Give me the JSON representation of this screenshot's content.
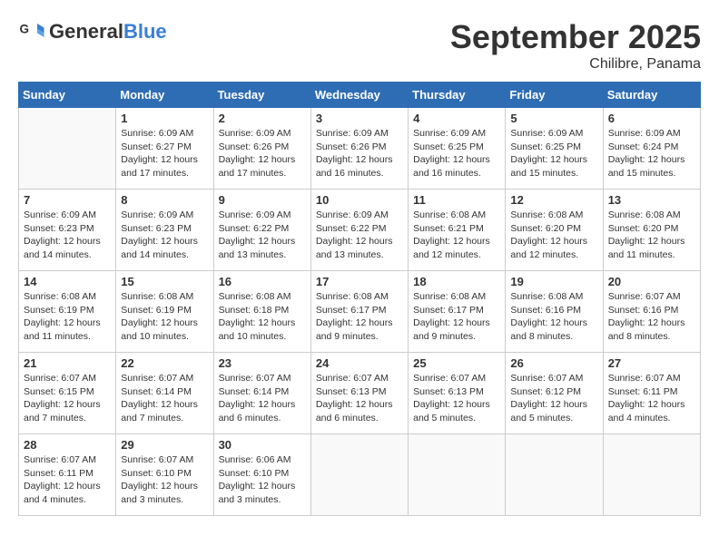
{
  "logo": {
    "general": "General",
    "blue": "Blue"
  },
  "title": "September 2025",
  "location": "Chilibre, Panama",
  "days_of_week": [
    "Sunday",
    "Monday",
    "Tuesday",
    "Wednesday",
    "Thursday",
    "Friday",
    "Saturday"
  ],
  "weeks": [
    [
      {
        "day": "",
        "info": ""
      },
      {
        "day": "1",
        "info": "Sunrise: 6:09 AM\nSunset: 6:27 PM\nDaylight: 12 hours and 17 minutes."
      },
      {
        "day": "2",
        "info": "Sunrise: 6:09 AM\nSunset: 6:26 PM\nDaylight: 12 hours and 17 minutes."
      },
      {
        "day": "3",
        "info": "Sunrise: 6:09 AM\nSunset: 6:26 PM\nDaylight: 12 hours and 16 minutes."
      },
      {
        "day": "4",
        "info": "Sunrise: 6:09 AM\nSunset: 6:25 PM\nDaylight: 12 hours and 16 minutes."
      },
      {
        "day": "5",
        "info": "Sunrise: 6:09 AM\nSunset: 6:25 PM\nDaylight: 12 hours and 15 minutes."
      },
      {
        "day": "6",
        "info": "Sunrise: 6:09 AM\nSunset: 6:24 PM\nDaylight: 12 hours and 15 minutes."
      }
    ],
    [
      {
        "day": "7",
        "info": "Sunrise: 6:09 AM\nSunset: 6:23 PM\nDaylight: 12 hours and 14 minutes."
      },
      {
        "day": "8",
        "info": "Sunrise: 6:09 AM\nSunset: 6:23 PM\nDaylight: 12 hours and 14 minutes."
      },
      {
        "day": "9",
        "info": "Sunrise: 6:09 AM\nSunset: 6:22 PM\nDaylight: 12 hours and 13 minutes."
      },
      {
        "day": "10",
        "info": "Sunrise: 6:09 AM\nSunset: 6:22 PM\nDaylight: 12 hours and 13 minutes."
      },
      {
        "day": "11",
        "info": "Sunrise: 6:08 AM\nSunset: 6:21 PM\nDaylight: 12 hours and 12 minutes."
      },
      {
        "day": "12",
        "info": "Sunrise: 6:08 AM\nSunset: 6:20 PM\nDaylight: 12 hours and 12 minutes."
      },
      {
        "day": "13",
        "info": "Sunrise: 6:08 AM\nSunset: 6:20 PM\nDaylight: 12 hours and 11 minutes."
      }
    ],
    [
      {
        "day": "14",
        "info": "Sunrise: 6:08 AM\nSunset: 6:19 PM\nDaylight: 12 hours and 11 minutes."
      },
      {
        "day": "15",
        "info": "Sunrise: 6:08 AM\nSunset: 6:19 PM\nDaylight: 12 hours and 10 minutes."
      },
      {
        "day": "16",
        "info": "Sunrise: 6:08 AM\nSunset: 6:18 PM\nDaylight: 12 hours and 10 minutes."
      },
      {
        "day": "17",
        "info": "Sunrise: 6:08 AM\nSunset: 6:17 PM\nDaylight: 12 hours and 9 minutes."
      },
      {
        "day": "18",
        "info": "Sunrise: 6:08 AM\nSunset: 6:17 PM\nDaylight: 12 hours and 9 minutes."
      },
      {
        "day": "19",
        "info": "Sunrise: 6:08 AM\nSunset: 6:16 PM\nDaylight: 12 hours and 8 minutes."
      },
      {
        "day": "20",
        "info": "Sunrise: 6:07 AM\nSunset: 6:16 PM\nDaylight: 12 hours and 8 minutes."
      }
    ],
    [
      {
        "day": "21",
        "info": "Sunrise: 6:07 AM\nSunset: 6:15 PM\nDaylight: 12 hours and 7 minutes."
      },
      {
        "day": "22",
        "info": "Sunrise: 6:07 AM\nSunset: 6:14 PM\nDaylight: 12 hours and 7 minutes."
      },
      {
        "day": "23",
        "info": "Sunrise: 6:07 AM\nSunset: 6:14 PM\nDaylight: 12 hours and 6 minutes."
      },
      {
        "day": "24",
        "info": "Sunrise: 6:07 AM\nSunset: 6:13 PM\nDaylight: 12 hours and 6 minutes."
      },
      {
        "day": "25",
        "info": "Sunrise: 6:07 AM\nSunset: 6:13 PM\nDaylight: 12 hours and 5 minutes."
      },
      {
        "day": "26",
        "info": "Sunrise: 6:07 AM\nSunset: 6:12 PM\nDaylight: 12 hours and 5 minutes."
      },
      {
        "day": "27",
        "info": "Sunrise: 6:07 AM\nSunset: 6:11 PM\nDaylight: 12 hours and 4 minutes."
      }
    ],
    [
      {
        "day": "28",
        "info": "Sunrise: 6:07 AM\nSunset: 6:11 PM\nDaylight: 12 hours and 4 minutes."
      },
      {
        "day": "29",
        "info": "Sunrise: 6:07 AM\nSunset: 6:10 PM\nDaylight: 12 hours and 3 minutes."
      },
      {
        "day": "30",
        "info": "Sunrise: 6:06 AM\nSunset: 6:10 PM\nDaylight: 12 hours and 3 minutes."
      },
      {
        "day": "",
        "info": ""
      },
      {
        "day": "",
        "info": ""
      },
      {
        "day": "",
        "info": ""
      },
      {
        "day": "",
        "info": ""
      }
    ]
  ]
}
